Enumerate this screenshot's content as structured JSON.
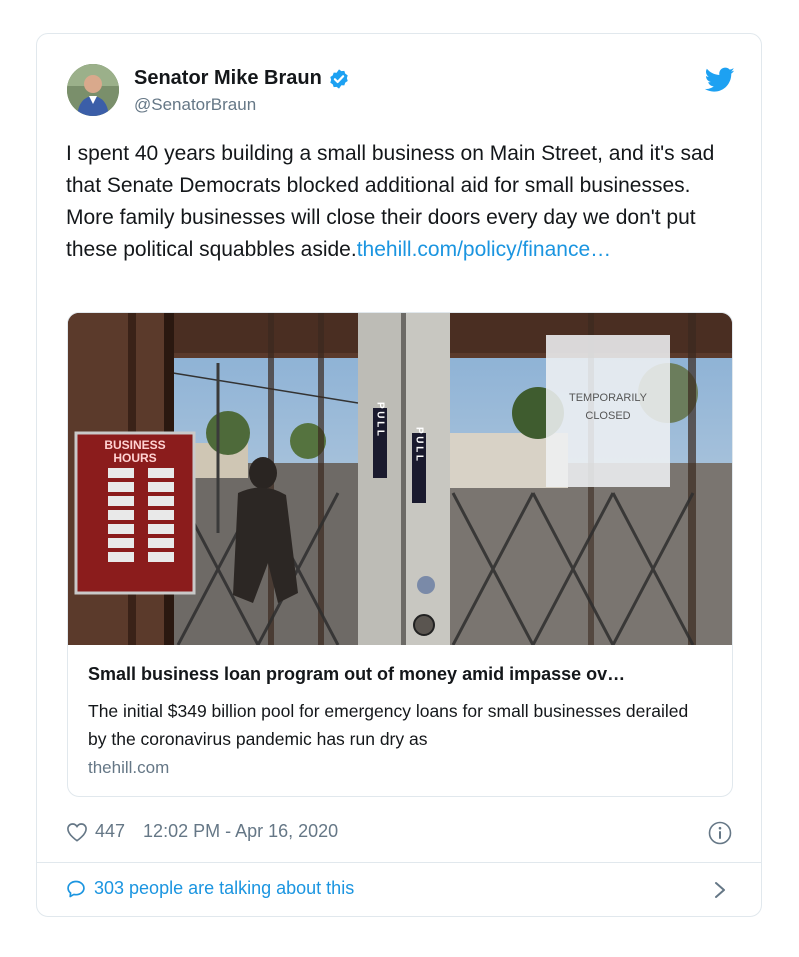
{
  "tweet": {
    "author_name": "Senator Mike Braun",
    "author_handle": "@SenatorBraun",
    "text": "I spent 40 years building a small business on Main Street, and it's sad that Senate Democrats blocked additional aid for small businesses. More family businesses will close their doors every day we don't put these political squabbles aside.",
    "link_text": "thehill.com/policy/finance…",
    "likes": "447",
    "timestamp": "12:02 PM - Apr 16, 2020",
    "conversation": "303 people are talking about this"
  },
  "link_card": {
    "title": "Small business loan program out of money amid impasse ov…",
    "description": "The initial $349 billion pool for emergency loans for small businesses derailed by the coronavirus pandemic has run dry as",
    "domain": "thehill.com",
    "photo_sign_text": "TEMPORARILY CLOSED",
    "photo_hours_title": "BUSINESS HOURS",
    "photo_door_text": "PULL"
  },
  "colors": {
    "link": "#1b95e0",
    "secondary_text": "#657786",
    "border": "#e1e8ed",
    "verified": "#1da1f2"
  },
  "icons": [
    "verified-badge-icon",
    "twitter-bird-icon",
    "heart-icon",
    "info-icon",
    "speech-bubble-icon",
    "chevron-right-icon"
  ]
}
